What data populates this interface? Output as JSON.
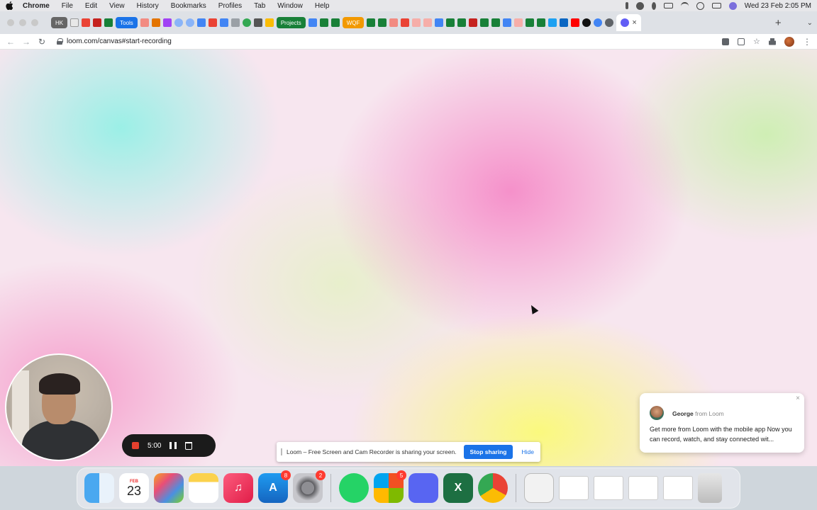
{
  "menubar": {
    "app": "Chrome",
    "items": [
      "File",
      "Edit",
      "View",
      "History",
      "Bookmarks",
      "Profiles",
      "Tab",
      "Window",
      "Help"
    ],
    "clock": "Wed 23 Feb  2:05 PM"
  },
  "tabstrip": {
    "groups": [
      "HK",
      "Tools",
      "Projects",
      "WQF"
    ],
    "close_glyph": "×",
    "newtab_glyph": "+",
    "menu_glyph": "⌄"
  },
  "addressbar": {
    "back": "←",
    "forward": "→",
    "reload": "↻",
    "url": "loom.com/canvas#start-recording"
  },
  "recorder": {
    "timer": "5:00"
  },
  "share_banner": {
    "text": "Loom – Free Screen and Cam Recorder is sharing your screen.",
    "stop_label": "Stop sharing",
    "hide_label": "Hide"
  },
  "notification": {
    "sender": "George",
    "from": "from Loom",
    "message": "Get more from Loom with the mobile app Now you can record, watch, and stay connected wit...",
    "close": "×"
  },
  "dock": {
    "calendar_month": "FEB",
    "calendar_day": "23",
    "badges": {
      "appstore": "8",
      "settings": "2",
      "office": "5"
    }
  },
  "colors": {
    "stop_sharing": "#1a73e8",
    "record_stop": "#e5402e",
    "badge": "#ff3b30"
  }
}
